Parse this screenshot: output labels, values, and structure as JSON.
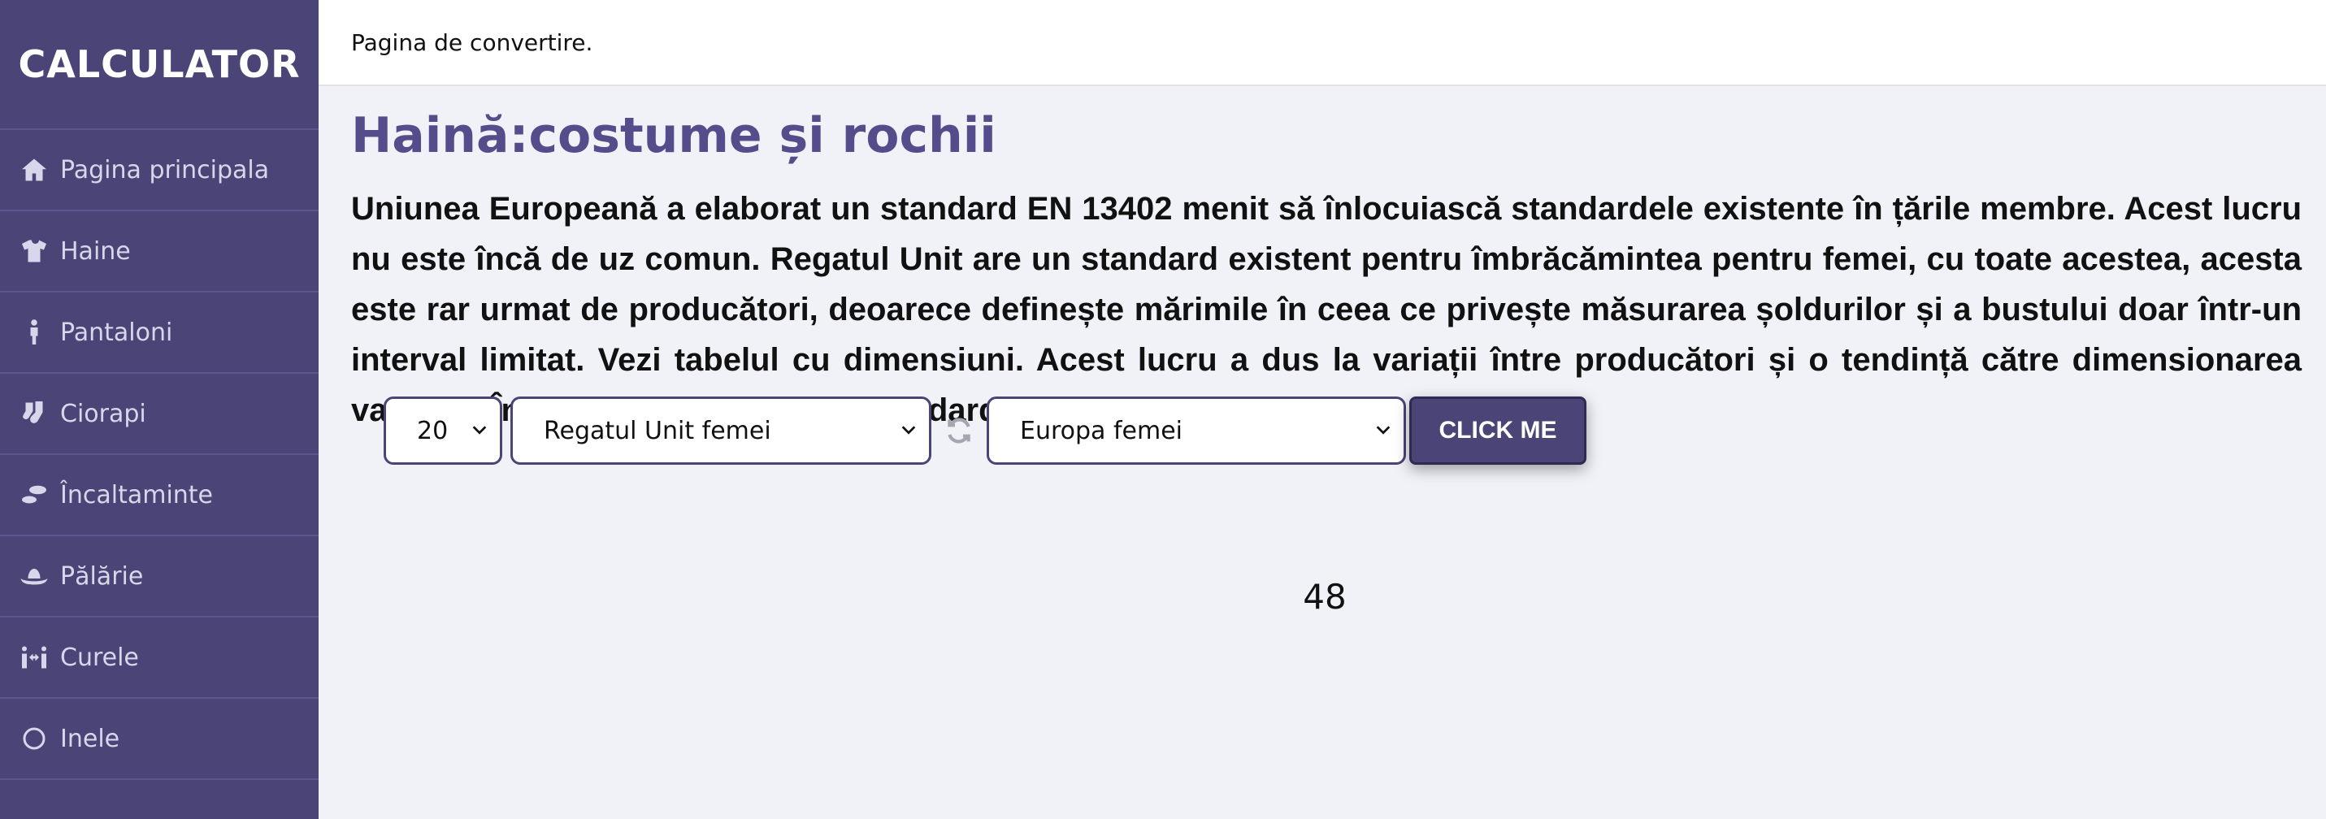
{
  "sidebar": {
    "brand": "CALCULATOR",
    "items": [
      {
        "label": "Pagina principala",
        "icon": "home-icon"
      },
      {
        "label": "Haine",
        "icon": "tshirt-icon"
      },
      {
        "label": "Pantaloni",
        "icon": "person-icon"
      },
      {
        "label": "Ciorapi",
        "icon": "socks-icon"
      },
      {
        "label": "Încaltaminte",
        "icon": "shoe-prints-icon"
      },
      {
        "label": "Pălărie",
        "icon": "hat-icon"
      },
      {
        "label": "Curele",
        "icon": "people-arrows-icon"
      },
      {
        "label": "Inele",
        "icon": "ring-icon"
      }
    ]
  },
  "topbar": {
    "text": "Pagina de convertire."
  },
  "main": {
    "title": "Haină:costume și rochii",
    "description": "Uniunea Europeană a elaborat un standard EN 13402 menit să înlocuiască standardele existente în țările membre. Acest lucru nu este încă de uz comun. Regatul Unit are un standard existent pentru îmbrăcămintea pentru femei, cu toate acestea, acesta este rar urmat de producători, deoarece definește mărimile în ceea ce privește măsurarea șoldurilor și a bustului doar într-un interval limitat. Vezi tabelul cu dimensiuni. Acest lucru a dus la variații între producători și o tendință către dimensionarea vanității. În SUA există o mărime standard pentru îmbrăcăminte."
  },
  "converter": {
    "size_value": "20",
    "from_value": "Regatul Unit femei",
    "to_value": "Europa femei",
    "button_label": "CLICK ME",
    "result": "48"
  },
  "colors": {
    "sidebar_bg": "#4b4477",
    "accent": "#554c8c",
    "page_bg": "#f1f2f8"
  }
}
